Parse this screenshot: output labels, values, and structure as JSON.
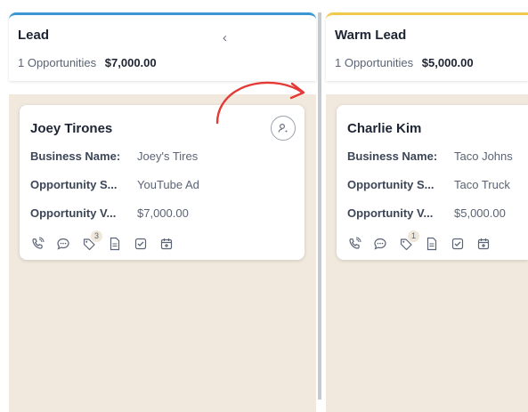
{
  "columns": [
    {
      "title": "Lead",
      "opportunity_count": "1 Opportunities",
      "total": "$7,000.00",
      "collapse_icon": "chevron-left-icon",
      "card": {
        "name": "Joey Tirones",
        "fields": [
          {
            "label": "Business Name:",
            "value": "Joey's Tires"
          },
          {
            "label": "Opportunity S...",
            "value": "YouTube Ad"
          },
          {
            "label": "Opportunity V...",
            "value": "$7,000.00"
          }
        ],
        "tag_count": "3"
      }
    },
    {
      "title": "Warm Lead",
      "opportunity_count": "1 Opportunities",
      "total": "$5,000.00",
      "card": {
        "name": "Charlie Kim",
        "fields": [
          {
            "label": "Business Name:",
            "value": "Taco Johns"
          },
          {
            "label": "Opportunity S...",
            "value": "Taco Truck"
          },
          {
            "label": "Opportunity V...",
            "value": "$5,000.00"
          }
        ],
        "tag_count": "1"
      }
    }
  ],
  "colors": {
    "lead_accent": "#3a97d4",
    "warm_lead_accent": "#f2c94c",
    "column_background": "#f1e9dd",
    "annotation_arrow": "#e53935"
  },
  "card_icons": [
    "phone-icon",
    "chat-icon",
    "tag-icon",
    "note-icon",
    "task-icon",
    "calendar-icon"
  ]
}
